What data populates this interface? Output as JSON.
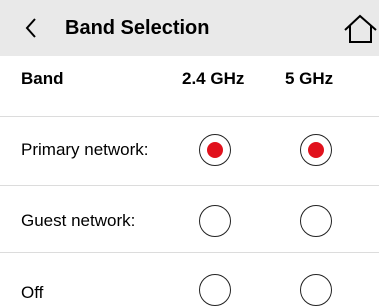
{
  "header": {
    "title": "Band Selection",
    "back_icon": "chevron-left-icon",
    "home_icon": "home-icon"
  },
  "table": {
    "columns": [
      "Band",
      "2.4 GHz",
      "5 GHz"
    ],
    "rows": [
      {
        "label": "Primary network:",
        "ghz24_selected": true,
        "ghz5_selected": true
      },
      {
        "label": "Guest network:",
        "ghz24_selected": false,
        "ghz5_selected": false
      },
      {
        "label": "Off",
        "ghz24_selected": false,
        "ghz5_selected": false
      }
    ]
  },
  "colors": {
    "header_background": "#e9e9e9",
    "selected_radio": "#e1111c",
    "divider": "#dcdcdc"
  }
}
